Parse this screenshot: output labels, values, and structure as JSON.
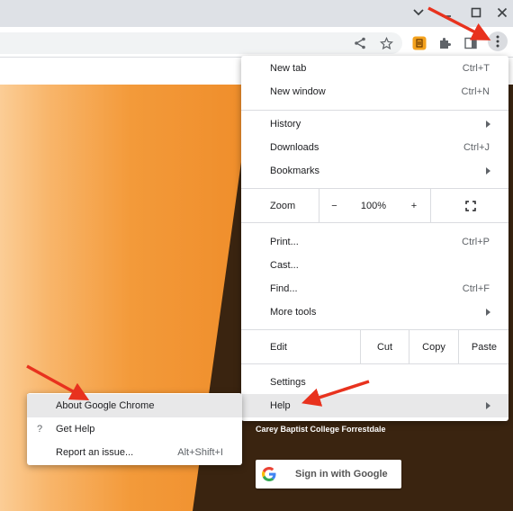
{
  "window_controls": [
    "chevron-down",
    "minimize",
    "maximize",
    "close"
  ],
  "menu": {
    "items": [
      {
        "label": "New tab",
        "shortcut": "Ctrl+T"
      },
      {
        "label": "New window",
        "shortcut": "Ctrl+N"
      },
      {
        "label": "History",
        "submenu": true
      },
      {
        "label": "Downloads",
        "shortcut": "Ctrl+J"
      },
      {
        "label": "Bookmarks",
        "submenu": true
      },
      {
        "label": "Print...",
        "shortcut": "Ctrl+P"
      },
      {
        "label": "Cast..."
      },
      {
        "label": "Find...",
        "shortcut": "Ctrl+F"
      },
      {
        "label": "More tools",
        "submenu": true
      },
      {
        "label": "Settings"
      },
      {
        "label": "Help",
        "submenu": true
      }
    ],
    "zoom": {
      "label": "Zoom",
      "minus": "−",
      "value": "100%",
      "plus": "+"
    },
    "edit": {
      "label": "Edit",
      "cut": "Cut",
      "copy": "Copy",
      "paste": "Paste"
    }
  },
  "help_submenu": {
    "items": [
      {
        "label": "About Google Chrome"
      },
      {
        "label": "Get Help",
        "icon": "?"
      },
      {
        "label": "Report an issue...",
        "shortcut": "Alt+Shift+I"
      }
    ]
  },
  "page": {
    "college": "Carey Baptist College Forrestdale",
    "signin": "Sign in with Google"
  },
  "colors": {
    "highlight": "#e8e8e9",
    "annotation_arrow": "#e8321e",
    "page_dark": "#3a2410",
    "page_orange": "#ef8d2a"
  }
}
